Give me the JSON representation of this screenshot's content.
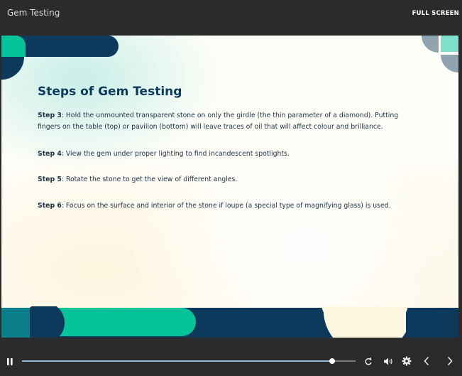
{
  "header": {
    "course_title": "Gem Testing",
    "fullscreen_label": "FULL SCREEN"
  },
  "slide": {
    "title": "Steps of Gem Testing",
    "steps": [
      {
        "label": "Step 3",
        "text": ": Hold the unmounted transparent stone on only the girdle (the thin parameter of a diamond). Putting fingers on the table (top) or pavilion (bottom) will leave traces of oil that will affect colour and brilliance."
      },
      {
        "label": "Step 4",
        "text": ": View the gem under proper lighting to find incandescent spotlights."
      },
      {
        "label": "Step 5",
        "text": ": Rotate the stone to get the view of different angles."
      },
      {
        "label": "Step 6",
        "text": ": Focus on the surface and interior of the stone if loupe (a special type of magnifying glass) is used."
      }
    ]
  },
  "player": {
    "progress_fraction": 0.93,
    "icons": [
      "pause-icon",
      "replay-icon",
      "volume-icon",
      "settings-icon",
      "previous-icon",
      "next-icon"
    ]
  },
  "colors": {
    "navy": "#0d3a5c",
    "teal": "#06c39a",
    "dark_teal": "#0a7f8a",
    "slate": "#8fa3b1",
    "mint": "#7fe0cc",
    "cream": "#fdf6e1",
    "chrome": "#2b2b2b"
  }
}
